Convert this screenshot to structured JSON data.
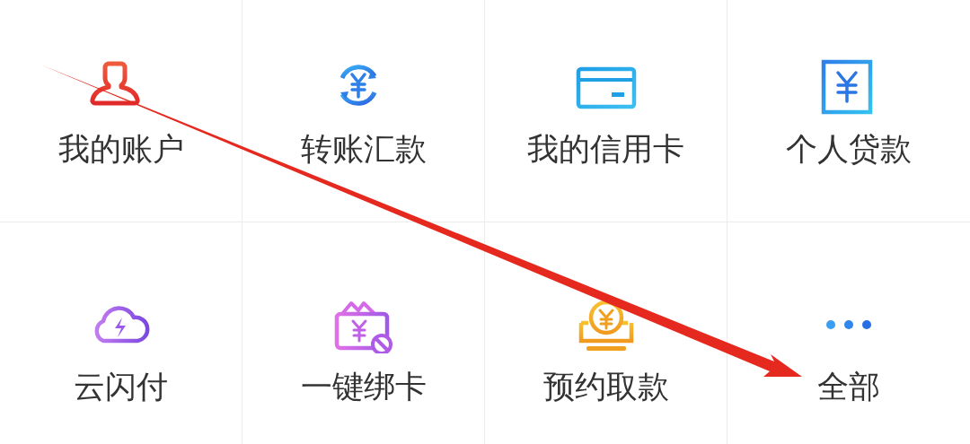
{
  "menu_items": [
    {
      "label": "我的账户",
      "kind": "account"
    },
    {
      "label": "转账汇款",
      "kind": "transfer"
    },
    {
      "label": "我的信用卡",
      "kind": "card"
    },
    {
      "label": "个人贷款",
      "kind": "loan"
    },
    {
      "label": "云闪付",
      "kind": "cloud"
    },
    {
      "label": "一键绑卡",
      "kind": "bind"
    },
    {
      "label": "预约取款",
      "kind": "withdraw"
    },
    {
      "label": "全部",
      "kind": "more"
    }
  ]
}
